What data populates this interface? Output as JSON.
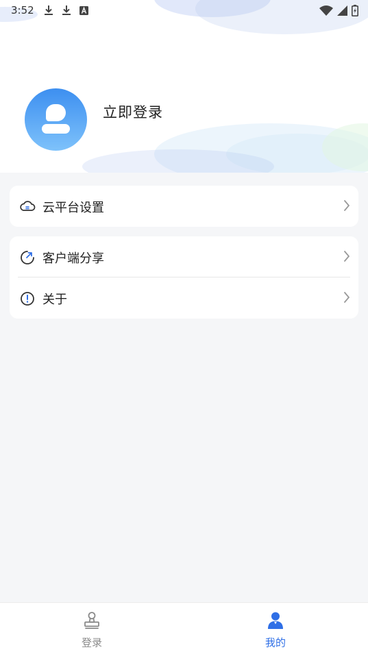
{
  "status_bar": {
    "time": "3:52",
    "left_icons": [
      "download-icon",
      "download-icon",
      "font-icon"
    ],
    "right_icons": [
      "wifi-icon",
      "signal-icon",
      "battery-charging-icon"
    ]
  },
  "profile": {
    "login_label": "立即登录",
    "avatar_colors": [
      "#3d8ff0",
      "#7ec2fb"
    ]
  },
  "menu": {
    "cloud_settings": {
      "label": "云平台设置",
      "icon": "cloud-icon"
    },
    "client_share": {
      "label": "客户端分享",
      "icon": "share-refresh-icon"
    },
    "about": {
      "label": "关于",
      "icon": "info-circle-icon"
    }
  },
  "tabbar": {
    "login": {
      "label": "登录",
      "icon": "stamp-icon",
      "active": false
    },
    "mine": {
      "label": "我的",
      "icon": "user-icon",
      "active": true
    }
  },
  "colors": {
    "accent": "#2f6fe6",
    "background": "#f5f6f8",
    "inactive": "#8a8a8a"
  }
}
